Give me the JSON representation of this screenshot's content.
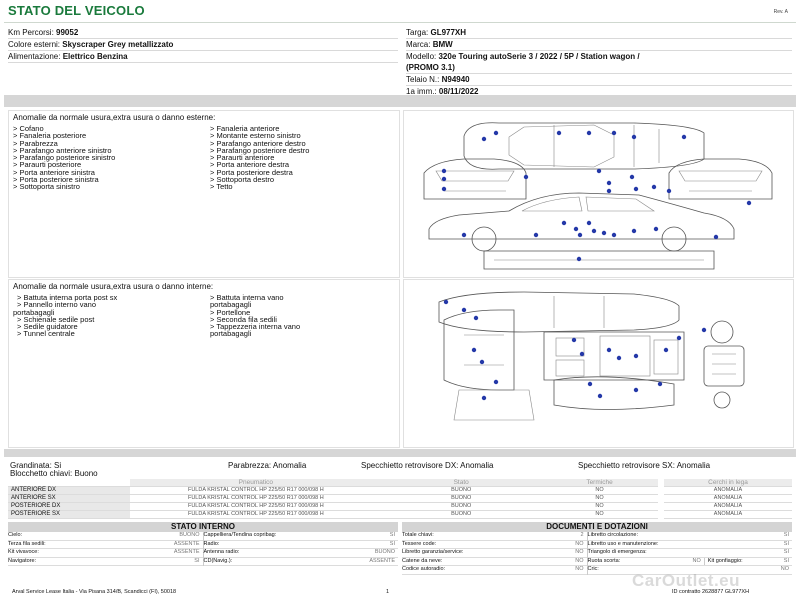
{
  "header": {
    "title": "STATO DEL VEICOLO",
    "rev": "Rev. A"
  },
  "info_left": [
    {
      "label": "Km Percorsi:",
      "value": "99052"
    },
    {
      "label": "Colore esterni:",
      "value": "Skyscraper Grey metallizzato"
    },
    {
      "label": "Alimentazione:",
      "value": "Elettrico Benzina"
    }
  ],
  "info_right": {
    "targa_label": "Targa:",
    "targa": "GL977XH",
    "marca_label": "Marca:",
    "marca": "BMW",
    "modello_label": "Modello:",
    "modello_1": "320e Touring autoSerie 3 / 2022 / 5P / Station wagon /",
    "modello_2": "(PROMO 3.1)",
    "telaio_label": "Telaio N.:",
    "telaio": "N94940",
    "imm_label": "1a imm.:",
    "imm": "08/11/2022"
  },
  "external": {
    "title": "Anomalie da normale usura,extra usura o danno esterne:",
    "col1": [
      "> Cofano",
      "> Fanaleria posteriore",
      "> Parabrezza",
      "> Parafango anteriore sinistro",
      "> Parafango posteriore sinistro",
      "> Paraurti posteriore",
      "> Porta anteriore sinistra",
      "> Porta posteriore sinistra",
      "> Sottoporta sinistro"
    ],
    "col2": [
      "> Fanaleria anteriore",
      "> Montante esterno sinistro",
      "> Parafango anteriore destro",
      "> Parafango posteriore destro",
      "> Paraurti anteriore",
      "> Porta anteriore destra",
      "> Porta posteriore destra",
      "> Sottoporta destro",
      "> Tetto"
    ]
  },
  "internal": {
    "title": "Anomalie da normale usura,extra usura o danno interne:",
    "col1": [
      "> Battuta interna porta post sx",
      "> Pannello interno vano",
      "portabagagli",
      "> Schienale sedile post",
      "> Sedile guidatore",
      "> Tunnel centrale"
    ],
    "col2": [
      "> Battuta interna vano",
      "portabagagli",
      "> Portellone",
      "> Seconda fila sedili",
      "> Tappezzeria interna vano",
      "portabagagli"
    ]
  },
  "summary": {
    "grandinata": "Grandinata: Si",
    "blocchetto": "Blocchetto chiavi: Buono",
    "parabrezza": "Parabrezza: Anomalia",
    "specchio_dx": "Specchietto retrovisore DX: Anomalia",
    "specchio_sx": "Specchietto retrovisore SX: Anomalia"
  },
  "tyres": {
    "headers": [
      "Pneumatico",
      "Stato",
      "Termiche",
      "Cerchi in lega"
    ],
    "rows": [
      {
        "pos": "ANTERIORE DX",
        "tyre": "FULDA KRISTAL CONTROL HP 225/50 R17 000/098 H",
        "stato": "BUONO",
        "termiche": "NO",
        "cerchi": "ANOMALIA"
      },
      {
        "pos": "ANTERIORE SX",
        "tyre": "FULDA KRISTAL CONTROL HP 225/50 R17 000/098 H",
        "stato": "BUONO",
        "termiche": "NO",
        "cerchi": "ANOMALIA"
      },
      {
        "pos": "POSTERIORE DX",
        "tyre": "FULDA KRISTAL CONTROL HP 225/50 R17 000/098 H",
        "stato": "BUONO",
        "termiche": "NO",
        "cerchi": "ANOMALIA"
      },
      {
        "pos": "POSTERIORE SX",
        "tyre": "FULDA KRISTAL CONTROL HP 225/50 R17 000/098 H",
        "stato": "BUONO",
        "termiche": "NO",
        "cerchi": "ANOMALIA"
      }
    ]
  },
  "stato_interno": {
    "title": "STATO INTERNO",
    "rows": [
      [
        {
          "k": "Cielo:",
          "v": "BUONO"
        },
        {
          "k": "Cappelliera/Tendina copribag:",
          "v": "SI"
        }
      ],
      [
        {
          "k": "Terza fila sedili:",
          "v": "ASSENTE"
        },
        {
          "k": "Radio:",
          "v": "SI"
        }
      ],
      [
        {
          "k": "Kit vivavoce:",
          "v": "ASSENTE"
        },
        {
          "k": "Antenna radio:",
          "v": "BUONO"
        }
      ],
      [
        {
          "k": "Navigatore:",
          "v": "SI"
        },
        {
          "k": "CD(Navig.):",
          "v": "ASSENTE"
        }
      ]
    ]
  },
  "documenti": {
    "title": "DOCUMENTI E DOTAZIONI",
    "rows": [
      [
        {
          "k": "Totale chiavi:",
          "v": "2"
        },
        {
          "k": "Libretto circolazione:",
          "v": "SI"
        }
      ],
      [
        {
          "k": "Tessere code:",
          "v": "NO"
        },
        {
          "k": "Libretto uso e manutenzione:",
          "v": "SI"
        }
      ],
      [
        {
          "k": "Libretto garanzia/service:",
          "v": "NO"
        },
        {
          "k": "Triangolo di emergenza:",
          "v": "SI"
        }
      ],
      [
        {
          "k": "Catene da neve:",
          "v": "NO"
        },
        {
          "k": "Ruota scorta:",
          "v": "NO"
        },
        {
          "k": "Kit gonfiaggio:",
          "v": "SI"
        }
      ],
      [
        {
          "k": "Codice autoradio:",
          "v": "NO"
        },
        {
          "k": "Cric:",
          "v": "NO"
        }
      ]
    ]
  },
  "footer": {
    "left": "Arval Service Lease Italia - Via Pisana 314/B, Scandicci (FI), 50018",
    "page": "1",
    "right": "ID contratto 2628877 GL977XH",
    "watermark": "CarOutlet.eu"
  }
}
